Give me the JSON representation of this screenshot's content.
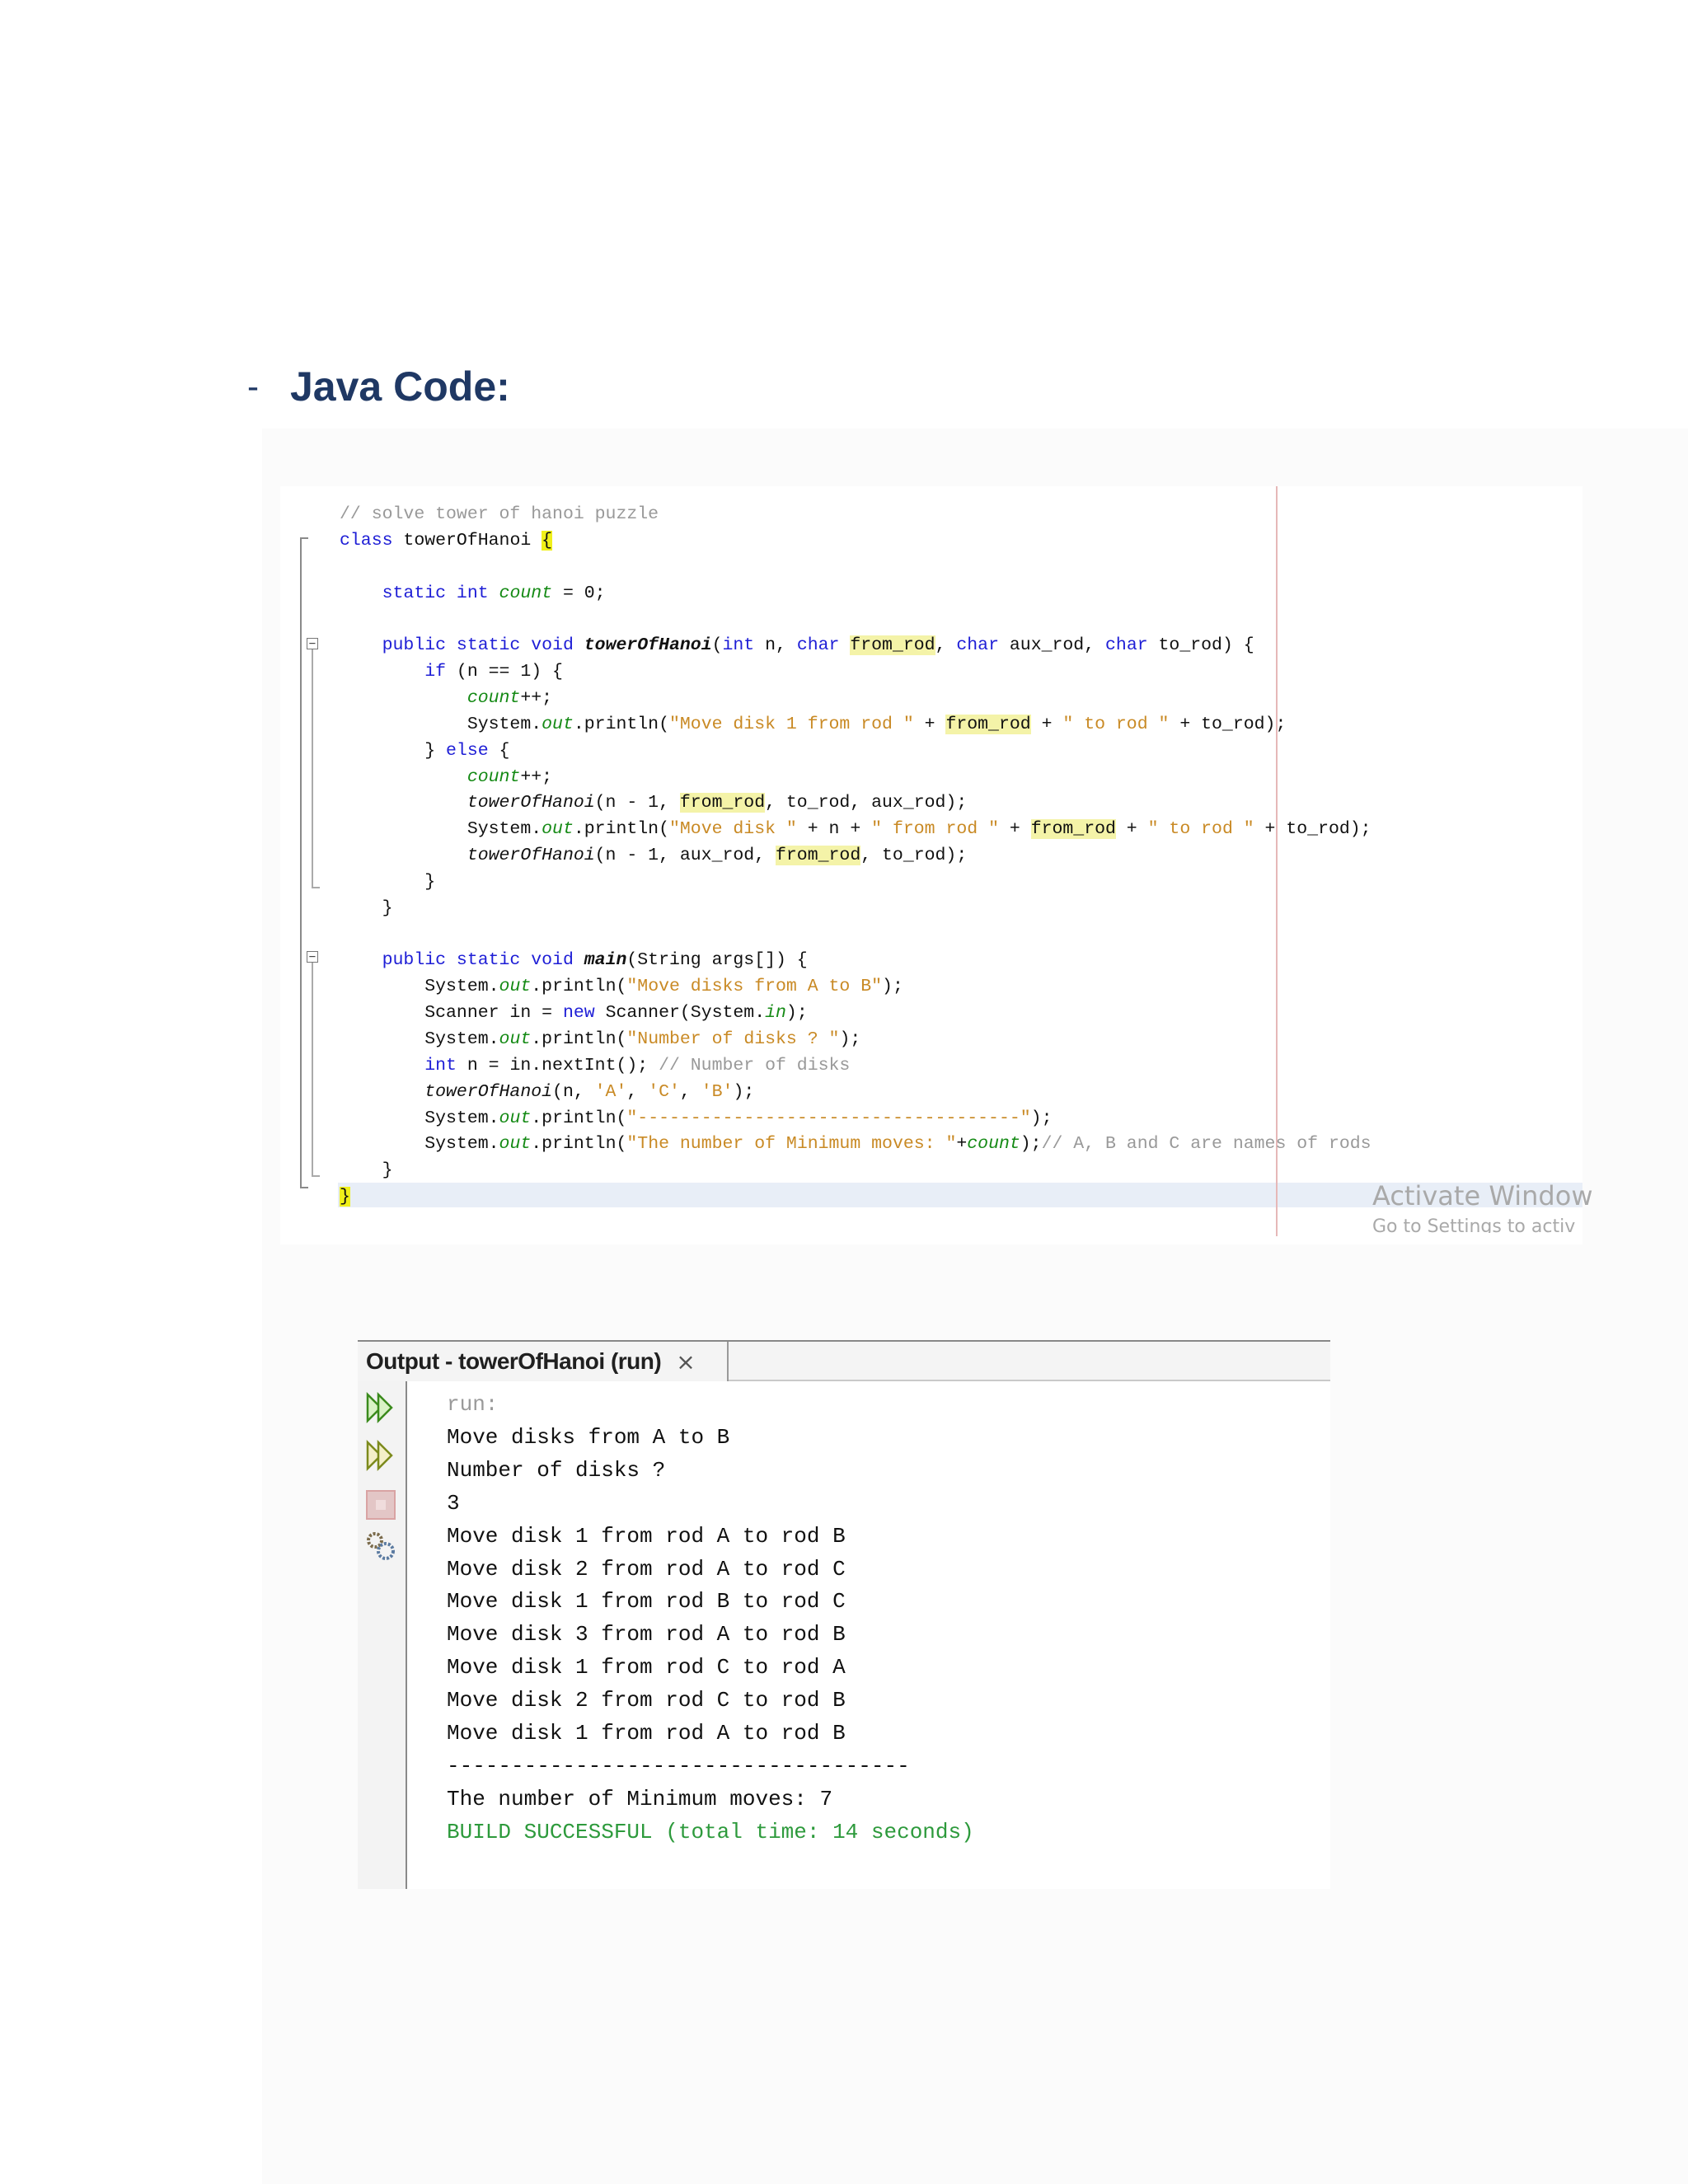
{
  "heading": {
    "bullet": "-",
    "title": "Java Code:"
  },
  "editor": {
    "code_lines": [
      [
        {
          "t": "// solve tower of hanoi puzzle",
          "c": "cmt"
        }
      ],
      [
        {
          "t": "class",
          "c": "kw"
        },
        {
          "t": " towerOfHanoi "
        },
        {
          "t": "{",
          "c": "hlb"
        }
      ],
      [],
      [
        {
          "t": "    "
        },
        {
          "t": "static int",
          "c": "kw"
        },
        {
          "t": " "
        },
        {
          "t": "count",
          "c": "fld"
        },
        {
          "t": " = 0;"
        }
      ],
      [],
      [
        {
          "t": "    "
        },
        {
          "t": "public static void",
          "c": "kw"
        },
        {
          "t": " "
        },
        {
          "t": "towerOfHanoi",
          "c": "mb"
        },
        {
          "t": "("
        },
        {
          "t": "int",
          "c": "kw"
        },
        {
          "t": " n, "
        },
        {
          "t": "char",
          "c": "kw"
        },
        {
          "t": " "
        },
        {
          "t": "from_rod",
          "c": "hl"
        },
        {
          "t": ", "
        },
        {
          "t": "char",
          "c": "kw"
        },
        {
          "t": " aux_rod, "
        },
        {
          "t": "char",
          "c": "kw"
        },
        {
          "t": " to_rod) {"
        }
      ],
      [
        {
          "t": "        "
        },
        {
          "t": "if",
          "c": "kw"
        },
        {
          "t": " (n == 1) {"
        }
      ],
      [
        {
          "t": "            "
        },
        {
          "t": "count",
          "c": "fld"
        },
        {
          "t": "++;"
        }
      ],
      [
        {
          "t": "            System."
        },
        {
          "t": "out",
          "c": "fld"
        },
        {
          "t": ".println("
        },
        {
          "t": "\"Move disk 1 from rod \"",
          "c": "str"
        },
        {
          "t": " + "
        },
        {
          "t": "from_rod",
          "c": "hl"
        },
        {
          "t": " + "
        },
        {
          "t": "\" to rod \"",
          "c": "str"
        },
        {
          "t": " + to_rod);"
        }
      ],
      [
        {
          "t": "        } "
        },
        {
          "t": "else",
          "c": "kw"
        },
        {
          "t": " {"
        }
      ],
      [
        {
          "t": "            "
        },
        {
          "t": "count",
          "c": "fld"
        },
        {
          "t": "++;"
        }
      ],
      [
        {
          "t": "            "
        },
        {
          "t": "towerOfHanoi",
          "c": "m"
        },
        {
          "t": "(n - 1, "
        },
        {
          "t": "from_rod",
          "c": "hl"
        },
        {
          "t": ", to_rod, aux_rod);"
        }
      ],
      [
        {
          "t": "            System."
        },
        {
          "t": "out",
          "c": "fld"
        },
        {
          "t": ".println("
        },
        {
          "t": "\"Move disk \"",
          "c": "str"
        },
        {
          "t": " + n + "
        },
        {
          "t": "\" from rod \"",
          "c": "str"
        },
        {
          "t": " + "
        },
        {
          "t": "from_rod",
          "c": "hl"
        },
        {
          "t": " + "
        },
        {
          "t": "\" to rod \"",
          "c": "str"
        },
        {
          "t": " + to_rod);"
        }
      ],
      [
        {
          "t": "            "
        },
        {
          "t": "towerOfHanoi",
          "c": "m"
        },
        {
          "t": "(n - 1, aux_rod, "
        },
        {
          "t": "from_rod",
          "c": "hl"
        },
        {
          "t": ", to_rod);"
        }
      ],
      [
        {
          "t": "        }"
        }
      ],
      [
        {
          "t": "    }"
        }
      ],
      [],
      [
        {
          "t": "    "
        },
        {
          "t": "public static void",
          "c": "kw"
        },
        {
          "t": " "
        },
        {
          "t": "main",
          "c": "mb"
        },
        {
          "t": "(String args[]) {"
        }
      ],
      [
        {
          "t": "        System."
        },
        {
          "t": "out",
          "c": "fld"
        },
        {
          "t": ".println("
        },
        {
          "t": "\"Move disks from A to B\"",
          "c": "str"
        },
        {
          "t": ");"
        }
      ],
      [
        {
          "t": "        Scanner in = "
        },
        {
          "t": "new",
          "c": "kw"
        },
        {
          "t": " Scanner(System."
        },
        {
          "t": "in",
          "c": "fld"
        },
        {
          "t": ");"
        }
      ],
      [
        {
          "t": "        System."
        },
        {
          "t": "out",
          "c": "fld"
        },
        {
          "t": ".println("
        },
        {
          "t": "\"Number of disks ? \"",
          "c": "str"
        },
        {
          "t": ");"
        }
      ],
      [
        {
          "t": "        "
        },
        {
          "t": "int",
          "c": "kw"
        },
        {
          "t": " n = in.nextInt(); "
        },
        {
          "t": "// Number of disks",
          "c": "cmt"
        }
      ],
      [
        {
          "t": "        "
        },
        {
          "t": "towerOfHanoi",
          "c": "m"
        },
        {
          "t": "(n, "
        },
        {
          "t": "'A'",
          "c": "str"
        },
        {
          "t": ", "
        },
        {
          "t": "'C'",
          "c": "str"
        },
        {
          "t": ", "
        },
        {
          "t": "'B'",
          "c": "str"
        },
        {
          "t": ");"
        }
      ],
      [
        {
          "t": "        System."
        },
        {
          "t": "out",
          "c": "fld"
        },
        {
          "t": ".println("
        },
        {
          "t": "\"------------------------------------\"",
          "c": "str"
        },
        {
          "t": ");"
        }
      ],
      [
        {
          "t": "        System."
        },
        {
          "t": "out",
          "c": "fld"
        },
        {
          "t": ".println("
        },
        {
          "t": "\"The number of Minimum moves: \"",
          "c": "str"
        },
        {
          "t": "+"
        },
        {
          "t": "count",
          "c": "fld"
        },
        {
          "t": ");"
        },
        {
          "t": "// A, B and C are names of rods",
          "c": "cmt"
        }
      ],
      [
        {
          "t": "    }"
        }
      ],
      [
        {
          "t": "}",
          "c": "hlb"
        }
      ]
    ],
    "watermark": {
      "line1": "Activate Window",
      "line2": "Go to Settings to activ"
    }
  },
  "output": {
    "tab_label": "Output - towerOfHanoi (run)",
    "close_glyph": "×",
    "gutter_icons": [
      "rerun-icon",
      "rerun-with-input-icon",
      "stop-icon",
      "settings-icon"
    ],
    "lines": [
      {
        "text": "run:",
        "style": "dim"
      },
      {
        "text": "Move disks from A to B",
        "style": ""
      },
      {
        "text": "Number of disks ?",
        "style": ""
      },
      {
        "text": "3",
        "style": ""
      },
      {
        "text": "Move disk 1 from rod A to rod B",
        "style": ""
      },
      {
        "text": "Move disk 2 from rod A to rod C",
        "style": ""
      },
      {
        "text": "Move disk 1 from rod B to rod C",
        "style": ""
      },
      {
        "text": "Move disk 3 from rod A to rod B",
        "style": ""
      },
      {
        "text": "Move disk 1 from rod C to rod A",
        "style": ""
      },
      {
        "text": "Move disk 2 from rod C to rod B",
        "style": ""
      },
      {
        "text": "Move disk 1 from rod A to rod B",
        "style": ""
      },
      {
        "text": "------------------------------------",
        "style": ""
      },
      {
        "text": "The number of Minimum moves: 7",
        "style": ""
      },
      {
        "text": "BUILD SUCCESSFUL (total time: 14 seconds)",
        "style": "ok"
      }
    ]
  }
}
